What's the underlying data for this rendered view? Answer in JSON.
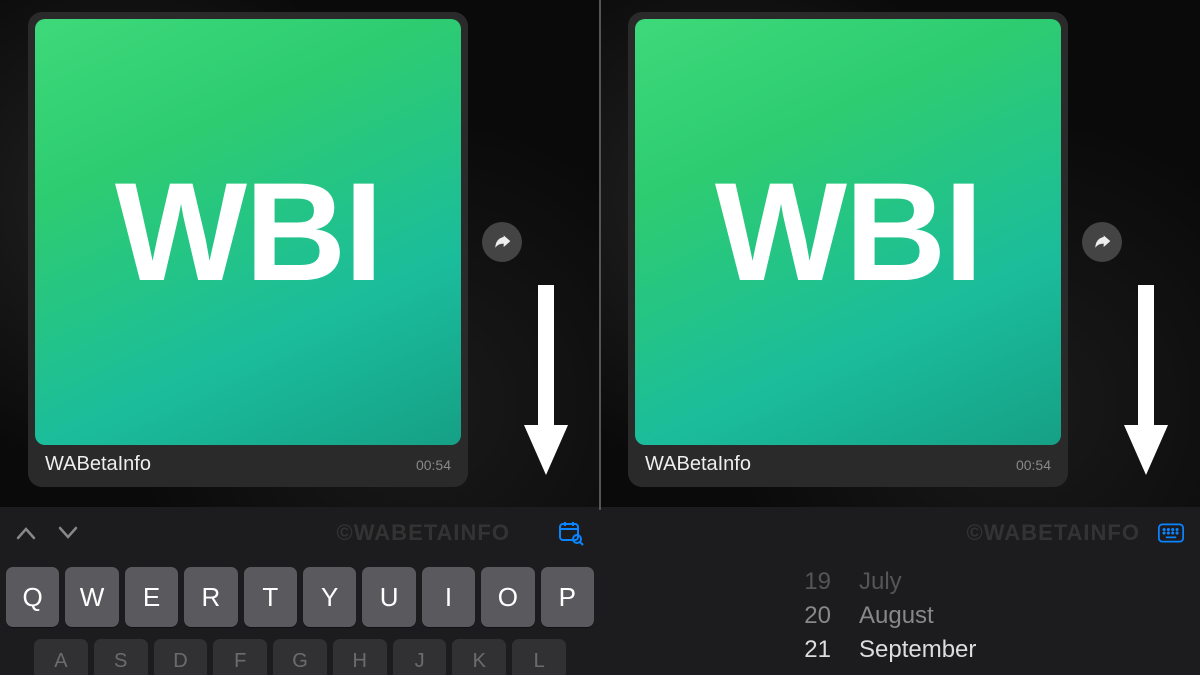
{
  "left": {
    "message": {
      "image_text": "WBI",
      "caption": "WABetaInfo",
      "time": "00:54"
    },
    "watermark": "©WABETAINFO",
    "keyboard": {
      "row1": [
        "Q",
        "W",
        "E",
        "R",
        "T",
        "Y",
        "U",
        "I",
        "O",
        "P"
      ],
      "row2": [
        "A",
        "S",
        "D",
        "F",
        "G",
        "H",
        "J",
        "K",
        "L"
      ]
    }
  },
  "right": {
    "message": {
      "image_text": "WBI",
      "caption": "WABetaInfo",
      "time": "00:54"
    },
    "watermark": "©WABETAINFO",
    "picker": {
      "rows": [
        {
          "num": "19",
          "label": "July"
        },
        {
          "num": "20",
          "label": "August"
        },
        {
          "num": "21",
          "label": "September"
        }
      ]
    }
  }
}
